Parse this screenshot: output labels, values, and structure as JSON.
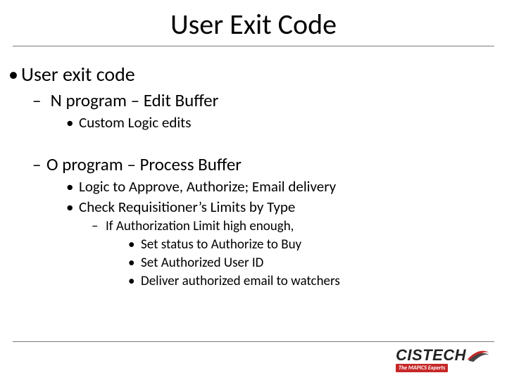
{
  "title": "User Exit Code",
  "b1": "User exit code",
  "b2a": " N program – Edit Buffer",
  "b3a": "Custom Logic edits",
  "b2b": "O program – Process Buffer",
  "b3b": "Logic to Approve, Authorize;  Email delivery",
  "b3c": "Check Requisitioner’s Limits by Type",
  "b4a": "If Authorization Limit high enough,",
  "b5a": "Set status to Authorize to Buy",
  "b5b": "Set Authorized User ID",
  "b5c": "Deliver authorized email to watchers",
  "logo": {
    "name": "CISTECH",
    "tag": "The MAPICS Experts"
  }
}
